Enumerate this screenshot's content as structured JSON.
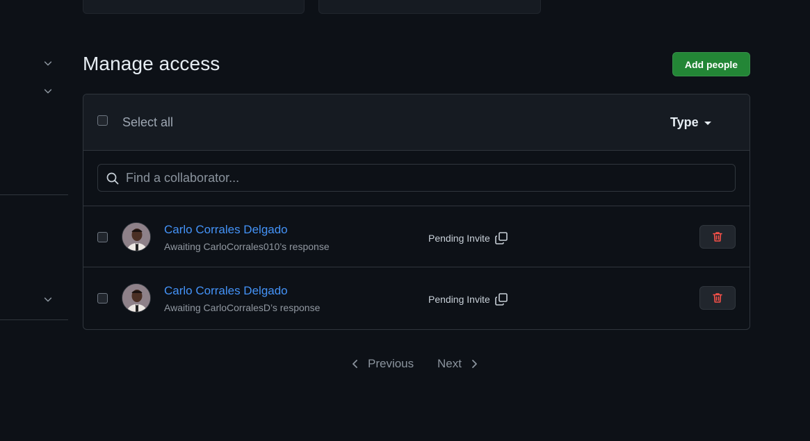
{
  "page": {
    "title": "Manage access",
    "add_button_label": "Add people"
  },
  "table": {
    "select_all_label": "Select all",
    "type_filter_label": "Type"
  },
  "search": {
    "placeholder": "Find a collaborator..."
  },
  "collaborators": [
    {
      "name": "Carlo Corrales Delgado",
      "subtext": "Awaiting CarloCorrales010’s response",
      "status": "Pending Invite"
    },
    {
      "name": "Carlo Corrales Delgado",
      "subtext": "Awaiting CarloCorralesD’s response",
      "status": "Pending Invite"
    }
  ],
  "pagination": {
    "previous_label": "Previous",
    "next_label": "Next"
  },
  "colors": {
    "background": "#0d1117",
    "accent_link": "#4493f8",
    "primary_button": "#238636",
    "danger": "#f85149"
  },
  "icons": {
    "left_nav": [
      "chevron-down-icon",
      "chevron-down-icon",
      "chevron-down-icon"
    ],
    "search": "search-icon",
    "copy": "copy-icon",
    "delete": "trash-icon",
    "type_filter": "caret-down-icon",
    "prev": "chevron-left-icon",
    "next": "chevron-right-icon"
  }
}
